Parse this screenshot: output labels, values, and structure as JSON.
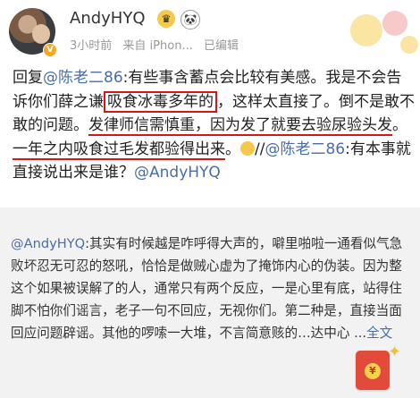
{
  "header": {
    "username": "AndyHYQ",
    "badge1": "♛",
    "badge2": "🐼",
    "time": "3小时前",
    "source": "来自 iPhon...",
    "edited": "已编辑"
  },
  "post": {
    "reply_prefix": "回复",
    "mention1": "@陈老二86",
    "text1": ":有些事含蓄点会比较有美感。我是不会告诉你们薛之谦",
    "highlight_box": "吸食冰毒多年的",
    "text2": "，这样太直接了。倒不是敢不敢的问题。",
    "underline1": "发律师信需慎重，因为发了就要去验尿验头发",
    "text3": "。",
    "underline2": "一年之内吸食过毛发都验得出来",
    "text4": "。",
    "slash": "//",
    "mention2": "@陈老二86",
    "text5": ":有本事就直接说出来是谁？",
    "mention3": "@AndyHYQ"
  },
  "repost": {
    "mention": "@AndyHYQ",
    "text": ":其实有时候越是咋呼得大声的，噼里啪啦一通看似气急败坏忍无可忍的怒吼，恰恰是做贼心虚为了掩饰内心的伪装。因为整这个如果被误解了的人，通常只有两个反应，一是心里有底，站得住脚不怕你们谣言，老子一句不回应，无视你们。第二种是，直接当面回应问题辟谣。其他的啰嗦一大堆，不言简意赅的…达中心 ...",
    "more": "全文"
  },
  "colors": {
    "link": "#4a6da7",
    "highlight": "#d01818",
    "repost_bg": "#f2f2f2"
  },
  "icons": [
    "avatar",
    "verified-badge-icon",
    "crown-badge-icon",
    "panda-badge-icon",
    "smiley-emoji-icon",
    "red-packet-icon"
  ]
}
